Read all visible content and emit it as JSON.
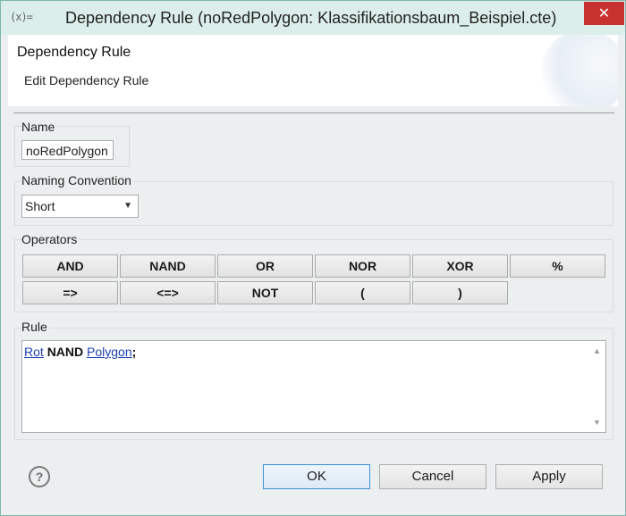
{
  "window": {
    "app_icon": "(x)=",
    "title": "Dependency Rule (noRedPolygon: Klassifikationsbaum_Beispiel.cte)",
    "close_glyph": "✕"
  },
  "header": {
    "title": "Dependency Rule",
    "subtitle": "Edit Dependency Rule"
  },
  "name_group": {
    "label": "Name",
    "value": "noRedPolygon"
  },
  "naming_group": {
    "label": "Naming Convention",
    "selected": "Short"
  },
  "operators_group": {
    "label": "Operators",
    "row1": [
      "AND",
      "NAND",
      "OR",
      "NOR",
      "XOR",
      "%"
    ],
    "row2": [
      "=>",
      "<=>",
      "NOT",
      "(",
      ")"
    ]
  },
  "rule_group": {
    "label": "Rule",
    "tokens": {
      "operand1": "Rot",
      "operator": "NAND",
      "operand2": "Polygon",
      "terminator": ";"
    }
  },
  "footer": {
    "help_glyph": "?",
    "ok": "OK",
    "cancel": "Cancel",
    "apply": "Apply"
  }
}
